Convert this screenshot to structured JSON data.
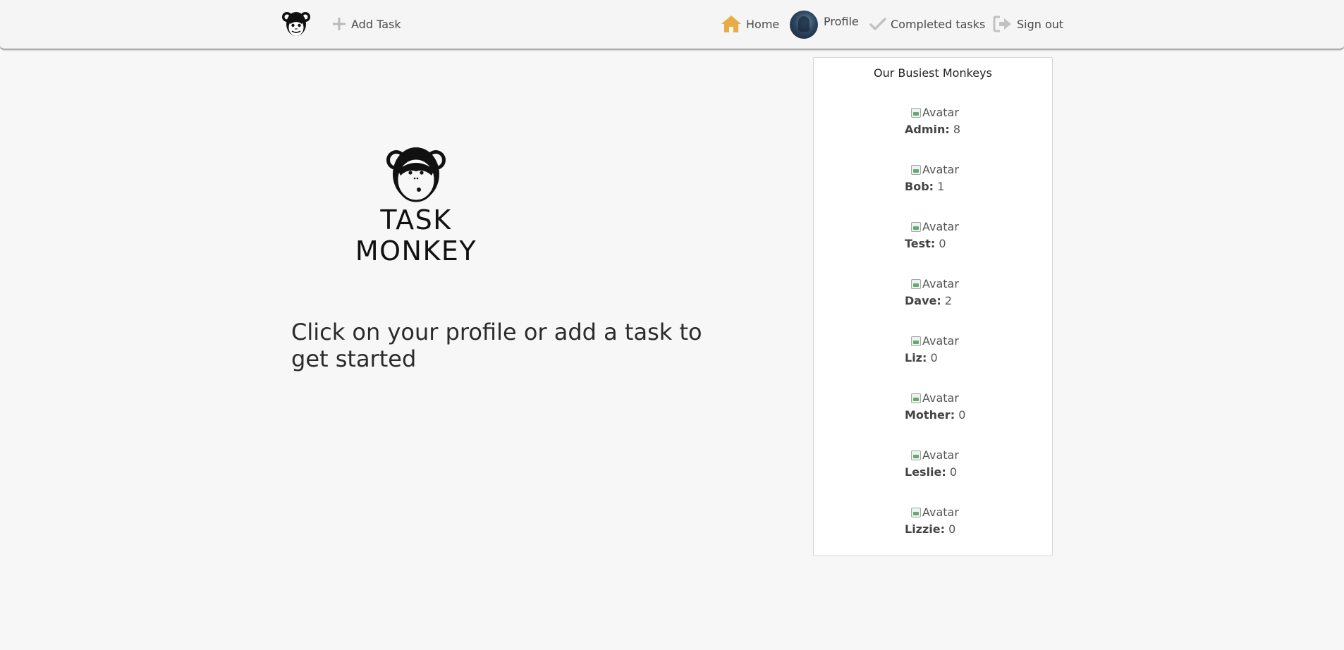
{
  "nav": {
    "add_task": "Add Task",
    "home": "Home",
    "profile": "Profile",
    "completed": "Completed tasks",
    "signout": "Sign out",
    "accent": "#e8ac45",
    "icons": [
      "monkey-logo-icon",
      "plus-icon",
      "home-icon",
      "avatar",
      "check-icon",
      "sign-out-icon"
    ]
  },
  "hero": {
    "logo_text": "TASK MONKEY",
    "headline": "Click on your profile or add a task to get started"
  },
  "sidebar": {
    "title": "Our Busiest Monkeys",
    "avatar_alt": "Avatar",
    "monkeys": [
      {
        "name": "Admin:",
        "count": "8"
      },
      {
        "name": "Bob:",
        "count": "1"
      },
      {
        "name": "Test:",
        "count": "0"
      },
      {
        "name": "Dave:",
        "count": "2"
      },
      {
        "name": "Liz:",
        "count": "0"
      },
      {
        "name": "Mother:",
        "count": "0"
      },
      {
        "name": "Leslie:",
        "count": "0"
      },
      {
        "name": "Lizzie:",
        "count": "0"
      }
    ]
  }
}
